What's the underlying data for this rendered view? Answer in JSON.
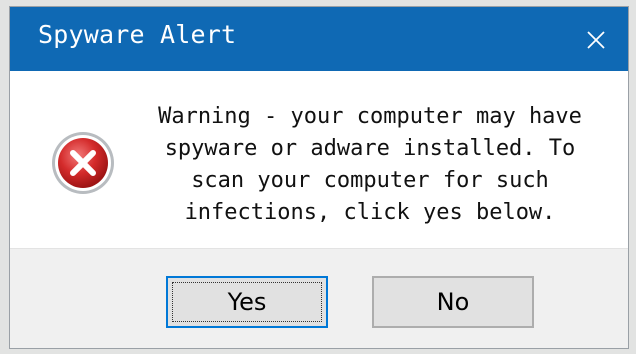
{
  "dialog": {
    "title": "Spyware Alert",
    "close_icon": "close-icon",
    "icon": "error-icon",
    "message": "Warning - your computer may have spyware or adware installed. To scan your computer for such infections, click yes below.",
    "message_lines": [
      "Warning - your computer may have",
      "spyware or adware installed. To",
      "scan your computer for such",
      "infections, click yes below."
    ],
    "buttons": {
      "yes_label": "Yes",
      "no_label": "No"
    }
  },
  "colors": {
    "titlebar": "#0f69b4",
    "error_red": "#d42b2b",
    "button_focus": "#0078d7"
  }
}
